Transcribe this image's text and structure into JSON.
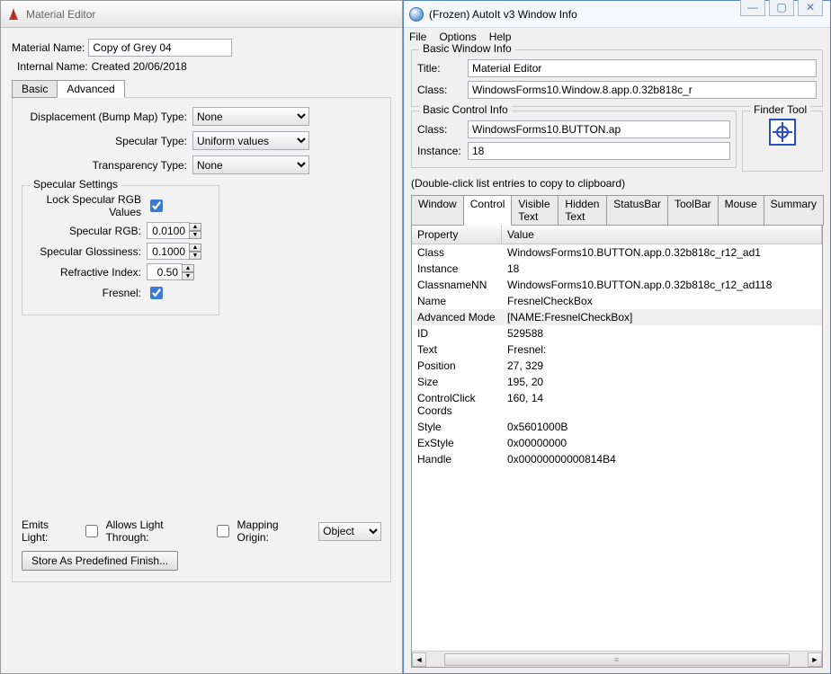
{
  "left": {
    "title": "Material Editor",
    "materialNameLabel": "Material Name:",
    "materialName": "Copy of Grey 04",
    "internalNameLabel": "Internal Name:",
    "internalName": "Created 20/06/2018",
    "tabs": {
      "basic": "Basic",
      "advanced": "Advanced"
    },
    "disp": {
      "label": "Displacement (Bump Map) Type:",
      "value": "None"
    },
    "spec": {
      "label": "Specular Type:",
      "value": "Uniform values"
    },
    "trans": {
      "label": "Transparency Type:",
      "value": "None"
    },
    "group": {
      "title": "Specular Settings",
      "lockLabel": "Lock Specular RGB Values",
      "rgbLabel": "Specular RGB:",
      "rgbValue": "0.0100",
      "glossLabel": "Specular Glossiness:",
      "glossValue": "0.1000",
      "refracLabel": "Refractive Index:",
      "refracValue": "0.50",
      "fresnelLabel": "Fresnel:"
    },
    "bottom": {
      "emits": "Emits Light:",
      "through": "Allows Light Through:",
      "mapOrigin": "Mapping Origin:",
      "mapOriginValue": "Object",
      "storeBtn": "Store As Predefined Finish..."
    }
  },
  "right": {
    "title": "(Frozen) AutoIt v3 Window Info",
    "menu": {
      "file": "File",
      "options": "Options",
      "help": "Help"
    },
    "winInfo": {
      "title": "Basic Window Info",
      "tLabel": "Title:",
      "tValue": "Material Editor",
      "cLabel": "Class:",
      "cValue": "WindowsForms10.Window.8.app.0.32b818c_r"
    },
    "ctrlInfo": {
      "title": "Basic Control Info",
      "cLabel": "Class:",
      "cValue": "WindowsForms10.BUTTON.ap",
      "iLabel": "Instance:",
      "iValue": "18"
    },
    "finder": {
      "title": "Finder Tool"
    },
    "hint": "(Double-click list entries to copy to clipboard)",
    "itabs": [
      "Window",
      "Control",
      "Visible Text",
      "Hidden Text",
      "StatusBar",
      "ToolBar",
      "Mouse",
      "Summary"
    ],
    "cols": {
      "prop": "Property",
      "val": "Value"
    },
    "rows": [
      {
        "p": "Class",
        "v": "WindowsForms10.BUTTON.app.0.32b818c_r12_ad1"
      },
      {
        "p": "Instance",
        "v": "18"
      },
      {
        "p": "ClassnameNN",
        "v": "WindowsForms10.BUTTON.app.0.32b818c_r12_ad118"
      },
      {
        "p": "Name",
        "v": "FresnelCheckBox"
      },
      {
        "p": "Advanced Mode",
        "v": "[NAME:FresnelCheckBox]",
        "sel": true
      },
      {
        "p": "ID",
        "v": "529588"
      },
      {
        "p": "Text",
        "v": "Fresnel:"
      },
      {
        "p": "Position",
        "v": "27, 329"
      },
      {
        "p": "Size",
        "v": "195, 20"
      },
      {
        "p": "ControlClick Coords",
        "v": "160, 14"
      },
      {
        "p": "Style",
        "v": "0x5601000B"
      },
      {
        "p": "ExStyle",
        "v": "0x00000000"
      },
      {
        "p": "Handle",
        "v": "0x00000000000814B4"
      }
    ]
  }
}
